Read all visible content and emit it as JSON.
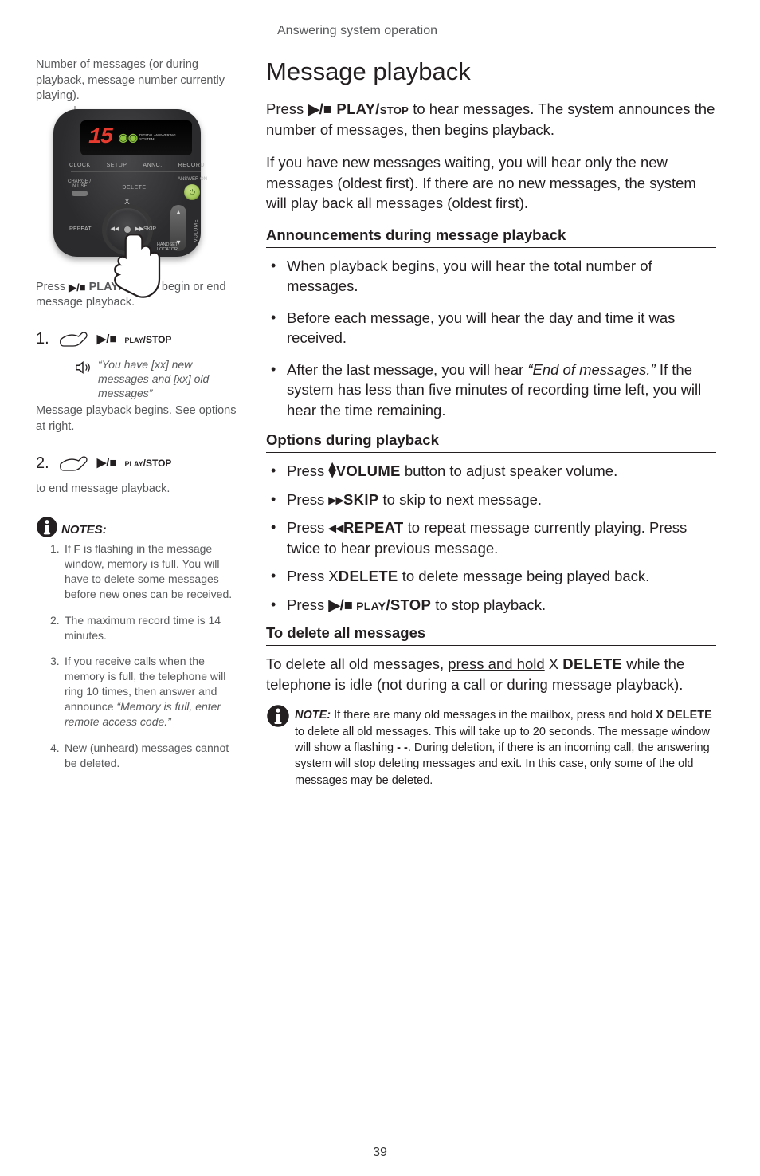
{
  "header": "Answering system operation",
  "left": {
    "intro": "Number of messages (or during playback, message number currently playing).",
    "device": {
      "display_value": "15",
      "labels_row1": [
        "CLOCK",
        "SETUP",
        "ANNC.",
        "RECORD"
      ],
      "charge_label": "CHARGE /\nIN USE",
      "delete_label": "DELETE",
      "answer_label": "ANSWER ON",
      "x_label": "X",
      "repeat_label": "REPEAT",
      "skip_label": "SKIP",
      "volume_label": "VOLUME",
      "handset_label": "HANDSET\nLOCATOR",
      "brand_sub": "DIGITAL\nANSWERING\nSYSTEM"
    },
    "press_line_pre": "Press ",
    "press_line_label": " PLAY/",
    "press_line_small": "STOP",
    "press_line_post": " to begin or end message playback.",
    "step1_num": "1.",
    "step_label_pre": "PLAY",
    "step_label_post": "/STOP",
    "voice_text": "“You have [xx] new messages and [xx] old messages”",
    "step1_post": "Message playback begins. See options at right.",
    "step2_num": "2.",
    "step2_post": "to end message playback.",
    "notes_title": "NOTES:",
    "notes": [
      {
        "n": "1",
        "html": "If <b>F</b> is flashing in the message window, memory is full. You will have to delete some messages before new ones can be received."
      },
      {
        "n": "2",
        "html": "The maximum record time is 14 minutes."
      },
      {
        "n": "3",
        "html": "If you receive calls when the memory is full, the telephone will ring 10 times, then answer and announce <i>“Memory is full, enter remote access code.”</i>"
      },
      {
        "n": "4",
        "html": "New (unheard) messages cannot be deleted."
      }
    ]
  },
  "right": {
    "title": "Message playback",
    "p1_pre": "Press ",
    "p1_label": " PLAY/",
    "p1_small": "STOP",
    "p1_post": " to hear messages. The system announces the number of messages, then begins playback.",
    "p2": "If you have new messages waiting, you will hear only the new messages (oldest first). If there are no new messages, the system will play back all messages (oldest first).",
    "h_announce": "Announcements during message playback",
    "a1": "When playback begins, you will hear the total number of messages.",
    "a2": "Before each message, you will hear the day and time it was received.",
    "a3_pre": "After the last message, you will hear ",
    "a3_em": "“End of messages.”",
    "a3_post": " If the system has less than five minutes of recording time left, you will hear the time remaining.",
    "h_options": "Options during playback",
    "o1_pre": "Press ",
    "o1_label": "VOLUME",
    "o1_post": " button to adjust speaker volume.",
    "o2_pre": "Press ",
    "o2_label": "SKIP",
    "o2_post": " to skip to next message.",
    "o3_pre": "Press ",
    "o3_label": "REPEAT",
    "o3_post": " to repeat message currently playing. Press twice to hear previous message.",
    "o4_pre": "Press X",
    "o4_label": "DELETE",
    "o4_post": " to delete message being played back.",
    "o5_pre": "Press ",
    "o5_label_pre": " PLAY",
    "o5_label_post": "/STOP",
    "o5_post": " to stop playback.",
    "h_delete": "To delete all messages",
    "del_p_pre": "To delete all old messages, ",
    "del_p_u": "press and hold",
    "del_p_mid": " X ",
    "del_p_label": "DELETE",
    "del_p_post": " while the telephone is idle (not during a call or during message playback).",
    "note_lead": "NOTE:",
    "note_body": " If there are many old messages in the mailbox, press and hold <b>X DELETE</b> to delete all old messages. This will take up to 20 seconds. The message window will show a flashing <b>- -</b>. During deletion, if there is an incoming call, the answering system will stop deleting messages and exit. In this case, only some of the old messages may be deleted."
  },
  "page_number": "39"
}
